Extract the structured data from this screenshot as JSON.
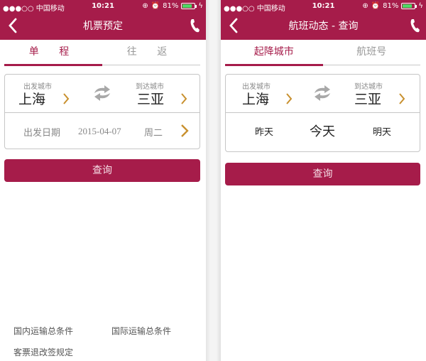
{
  "status_bar": {
    "carrier": "●●●○○ 中国移动",
    "time": "10:21",
    "battery_percent": "81%",
    "battery_level": 0.81
  },
  "colors": {
    "brand": "#a61c4a",
    "accent_chevron": "#c8902e",
    "battery_fill": "#4cd964"
  },
  "screens": [
    {
      "nav": {
        "title": "机票预定",
        "back_icon": "chevron-left-icon",
        "phone_icon": "phone-icon"
      },
      "tabs": [
        {
          "label": "单 程",
          "active": true
        },
        {
          "label": "往 返",
          "active": false
        }
      ],
      "route": {
        "from_label": "出发城市",
        "from_city": "上海",
        "to_label": "到达城市",
        "to_city": "三亚",
        "swap_icon": "swap-arrows-icon"
      },
      "date": {
        "label": "出发日期",
        "value": "2015-04-07",
        "weekday": "周二"
      },
      "search_label": "查询",
      "footer_links": [
        "国内运输总条件",
        "国际运输总条件",
        "客票退改签规定"
      ]
    },
    {
      "nav": {
        "title": "航班动态 - 查询",
        "back_icon": "chevron-left-icon",
        "phone_icon": "phone-icon"
      },
      "tabs": [
        {
          "label": "起降城市",
          "active": true
        },
        {
          "label": "航班号",
          "active": false
        }
      ],
      "route": {
        "from_label": "出发城市",
        "from_city": "上海",
        "to_label": "到达城市",
        "to_city": "三亚",
        "swap_icon": "swap-arrows-icon"
      },
      "days": [
        {
          "label": "昨天",
          "selected": false
        },
        {
          "label": "今天",
          "selected": true
        },
        {
          "label": "明天",
          "selected": false
        }
      ],
      "search_label": "查询"
    }
  ]
}
